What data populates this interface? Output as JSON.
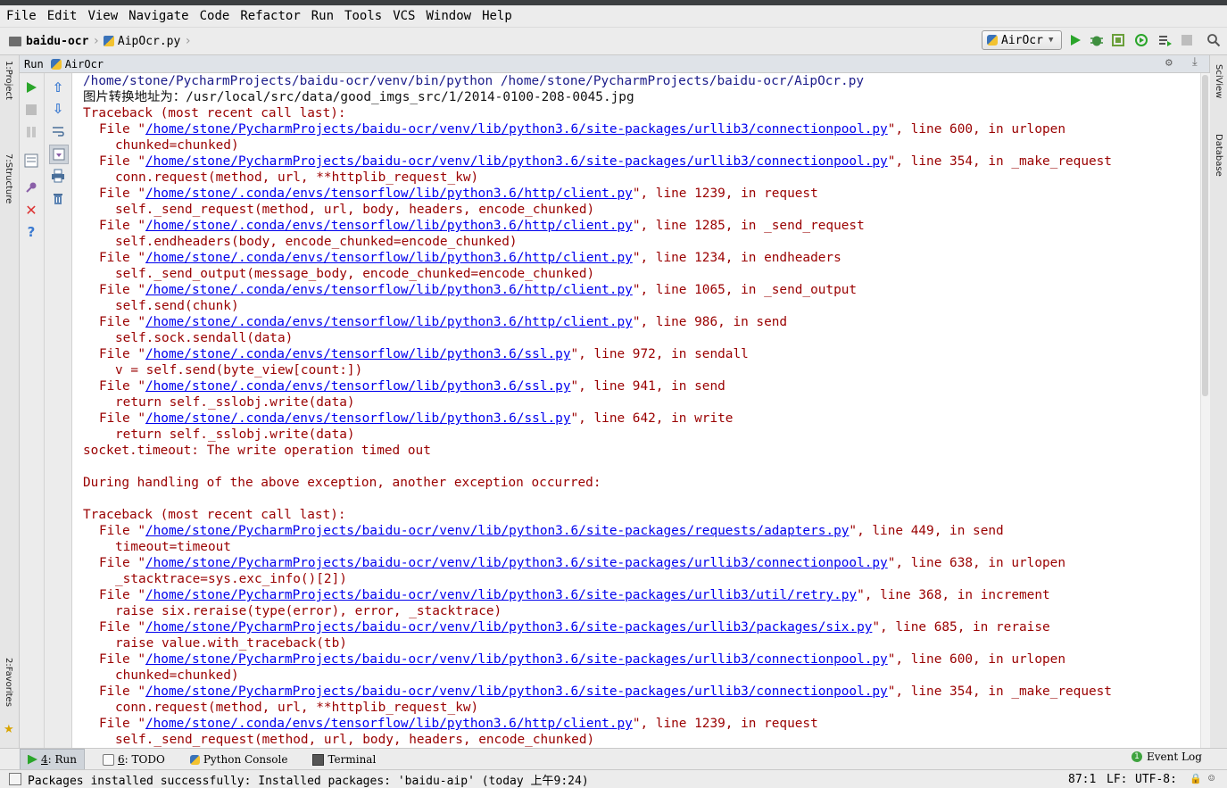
{
  "menu": [
    "File",
    "Edit",
    "View",
    "Navigate",
    "Code",
    "Refactor",
    "Run",
    "Tools",
    "VCS",
    "Window",
    "Help"
  ],
  "breadcrumb": {
    "project": "baidu-ocr",
    "file": "AipOcr.py"
  },
  "run_config": "AirOcr",
  "run_panel": {
    "run_label": "Run",
    "config_name": "AirOcr"
  },
  "console_lines": [
    {
      "t": "cmd",
      "text": "/home/stone/PycharmProjects/baidu-ocr/venv/bin/python /home/stone/PycharmProjects/baidu-ocr/AipOcr.py"
    },
    {
      "t": "out",
      "text": "图片转换地址为：/usr/local/src/data/good_imgs_src/1/2014-0100-208-0045.jpg"
    },
    {
      "t": "err",
      "text": "Traceback (most recent call last):"
    },
    {
      "t": "file",
      "path": "/home/stone/PycharmProjects/baidu-ocr/venv/lib/python3.6/site-packages/urllib3/connectionpool.py",
      "rest": "\", line 600, in urlopen"
    },
    {
      "t": "code",
      "text": "chunked=chunked)"
    },
    {
      "t": "file",
      "path": "/home/stone/PycharmProjects/baidu-ocr/venv/lib/python3.6/site-packages/urllib3/connectionpool.py",
      "rest": "\", line 354, in _make_request"
    },
    {
      "t": "code",
      "text": "conn.request(method, url, **httplib_request_kw)"
    },
    {
      "t": "file",
      "path": "/home/stone/.conda/envs/tensorflow/lib/python3.6/http/client.py",
      "rest": "\", line 1239, in request"
    },
    {
      "t": "code",
      "text": "self._send_request(method, url, body, headers, encode_chunked)"
    },
    {
      "t": "file",
      "path": "/home/stone/.conda/envs/tensorflow/lib/python3.6/http/client.py",
      "rest": "\", line 1285, in _send_request"
    },
    {
      "t": "code",
      "text": "self.endheaders(body, encode_chunked=encode_chunked)"
    },
    {
      "t": "file",
      "path": "/home/stone/.conda/envs/tensorflow/lib/python3.6/http/client.py",
      "rest": "\", line 1234, in endheaders"
    },
    {
      "t": "code",
      "text": "self._send_output(message_body, encode_chunked=encode_chunked)"
    },
    {
      "t": "file",
      "path": "/home/stone/.conda/envs/tensorflow/lib/python3.6/http/client.py",
      "rest": "\", line 1065, in _send_output"
    },
    {
      "t": "code",
      "text": "self.send(chunk)"
    },
    {
      "t": "file",
      "path": "/home/stone/.conda/envs/tensorflow/lib/python3.6/http/client.py",
      "rest": "\", line 986, in send"
    },
    {
      "t": "code",
      "text": "self.sock.sendall(data)"
    },
    {
      "t": "file",
      "path": "/home/stone/.conda/envs/tensorflow/lib/python3.6/ssl.py",
      "rest": "\", line 972, in sendall"
    },
    {
      "t": "code",
      "text": "v = self.send(byte_view[count:])"
    },
    {
      "t": "file",
      "path": "/home/stone/.conda/envs/tensorflow/lib/python3.6/ssl.py",
      "rest": "\", line 941, in send"
    },
    {
      "t": "code",
      "text": "return self._sslobj.write(data)"
    },
    {
      "t": "file",
      "path": "/home/stone/.conda/envs/tensorflow/lib/python3.6/ssl.py",
      "rest": "\", line 642, in write"
    },
    {
      "t": "code",
      "text": "return self._sslobj.write(data)"
    },
    {
      "t": "err",
      "text": "socket.timeout: The write operation timed out"
    },
    {
      "t": "err",
      "text": ""
    },
    {
      "t": "err",
      "text": "During handling of the above exception, another exception occurred:"
    },
    {
      "t": "err",
      "text": ""
    },
    {
      "t": "err",
      "text": "Traceback (most recent call last):"
    },
    {
      "t": "file",
      "path": "/home/stone/PycharmProjects/baidu-ocr/venv/lib/python3.6/site-packages/requests/adapters.py",
      "rest": "\", line 449, in send"
    },
    {
      "t": "code",
      "text": "timeout=timeout"
    },
    {
      "t": "file",
      "path": "/home/stone/PycharmProjects/baidu-ocr/venv/lib/python3.6/site-packages/urllib3/connectionpool.py",
      "rest": "\", line 638, in urlopen"
    },
    {
      "t": "code",
      "text": "_stacktrace=sys.exc_info()[2])"
    },
    {
      "t": "file",
      "path": "/home/stone/PycharmProjects/baidu-ocr/venv/lib/python3.6/site-packages/urllib3/util/retry.py",
      "rest": "\", line 368, in increment"
    },
    {
      "t": "code",
      "text": "raise six.reraise(type(error), error, _stacktrace)"
    },
    {
      "t": "file",
      "path": "/home/stone/PycharmProjects/baidu-ocr/venv/lib/python3.6/site-packages/urllib3/packages/six.py",
      "rest": "\", line 685, in reraise"
    },
    {
      "t": "code",
      "text": "raise value.with_traceback(tb)"
    },
    {
      "t": "file",
      "path": "/home/stone/PycharmProjects/baidu-ocr/venv/lib/python3.6/site-packages/urllib3/connectionpool.py",
      "rest": "\", line 600, in urlopen"
    },
    {
      "t": "code",
      "text": "chunked=chunked)"
    },
    {
      "t": "file",
      "path": "/home/stone/PycharmProjects/baidu-ocr/venv/lib/python3.6/site-packages/urllib3/connectionpool.py",
      "rest": "\", line 354, in _make_request"
    },
    {
      "t": "code",
      "text": "conn.request(method, url, **httplib_request_kw)"
    },
    {
      "t": "file",
      "path": "/home/stone/.conda/envs/tensorflow/lib/python3.6/http/client.py",
      "rest": "\", line 1239, in request"
    },
    {
      "t": "code",
      "text": "self._send_request(method, url, body, headers, encode_chunked)"
    }
  ],
  "file_prefix": "File \"",
  "bottom_tabs": [
    {
      "num": "4",
      "label": ": Run",
      "icon": "run-icon"
    },
    {
      "num": "6",
      "label": ": TODO",
      "icon": "todo-icon"
    },
    {
      "num": "",
      "label": "Python Console",
      "icon": "python-console-icon"
    },
    {
      "num": "",
      "label": "Terminal",
      "icon": "terminal-icon"
    }
  ],
  "event_log": "Event Log",
  "status": {
    "message": "Packages installed successfully: Installed packages: 'baidu-aip' (today 上午9:24)",
    "position": "87:1",
    "line_sep": "LF:",
    "encoding": "UTF-8:"
  },
  "colors": {
    "error": "#9a0000",
    "link": "#0000ee",
    "cmd": "#1c1c8a",
    "run_green": "#2aa52a"
  }
}
